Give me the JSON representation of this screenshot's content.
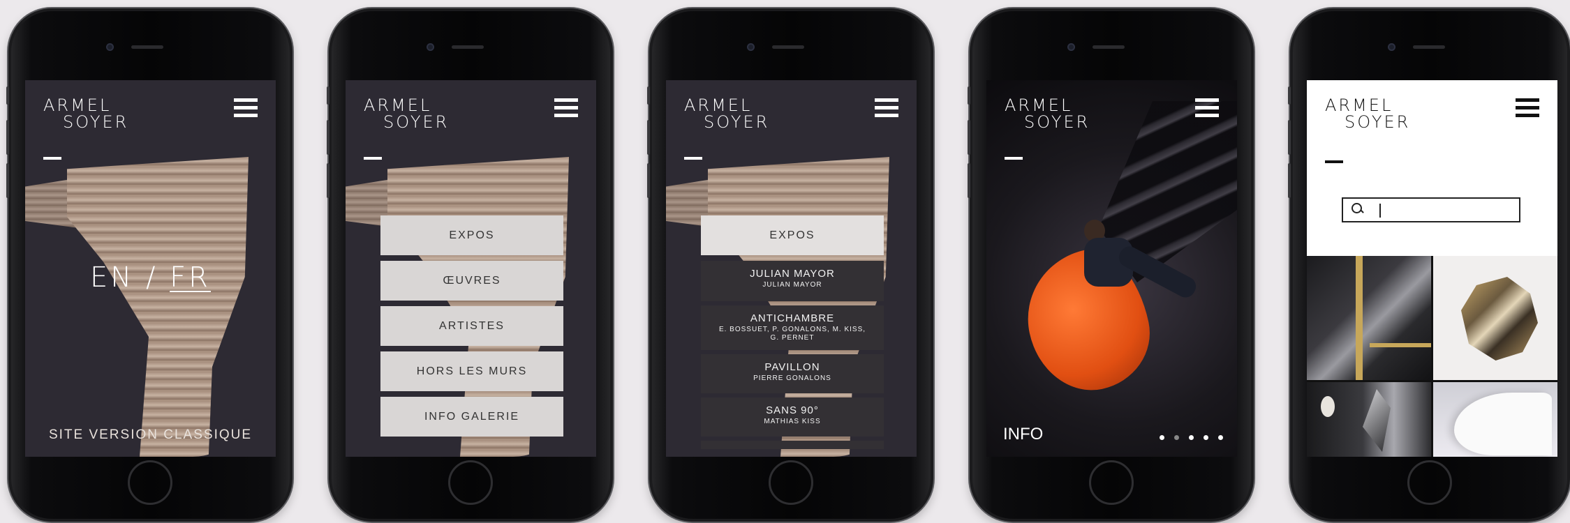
{
  "brand": {
    "line1": "ARMEL",
    "line2": "SOYER"
  },
  "phone1": {
    "lang_en": "EN",
    "lang_sep": "/",
    "lang_fr": "FR",
    "classic_link": "SITE VERSION CLASSIQUE"
  },
  "phone2": {
    "menu": [
      "EXPOS",
      "ŒUVRES",
      "ARTISTES",
      "HORS LES MURS",
      "INFO GALERIE"
    ]
  },
  "phone3": {
    "top": "EXPOS",
    "entries": [
      {
        "title": "JULIAN MAYOR",
        "subtitle": "JULIAN MAYOR"
      },
      {
        "title": "ANTICHAMBRE",
        "subtitle": "E. BOSSUET, P. GONALONS, M. KISS, G. PERNET"
      },
      {
        "title": "PAVILLON",
        "subtitle": "PIERRE GONALONS"
      },
      {
        "title": "SANS 90°",
        "subtitle": "MATHIAS KISS"
      }
    ]
  },
  "phone4": {
    "label": "INFO",
    "slides_total": 5,
    "slide_active": 2
  },
  "phone5": {
    "search_placeholder": ""
  },
  "icons": [
    "hamburger-menu-icon",
    "search-icon"
  ]
}
